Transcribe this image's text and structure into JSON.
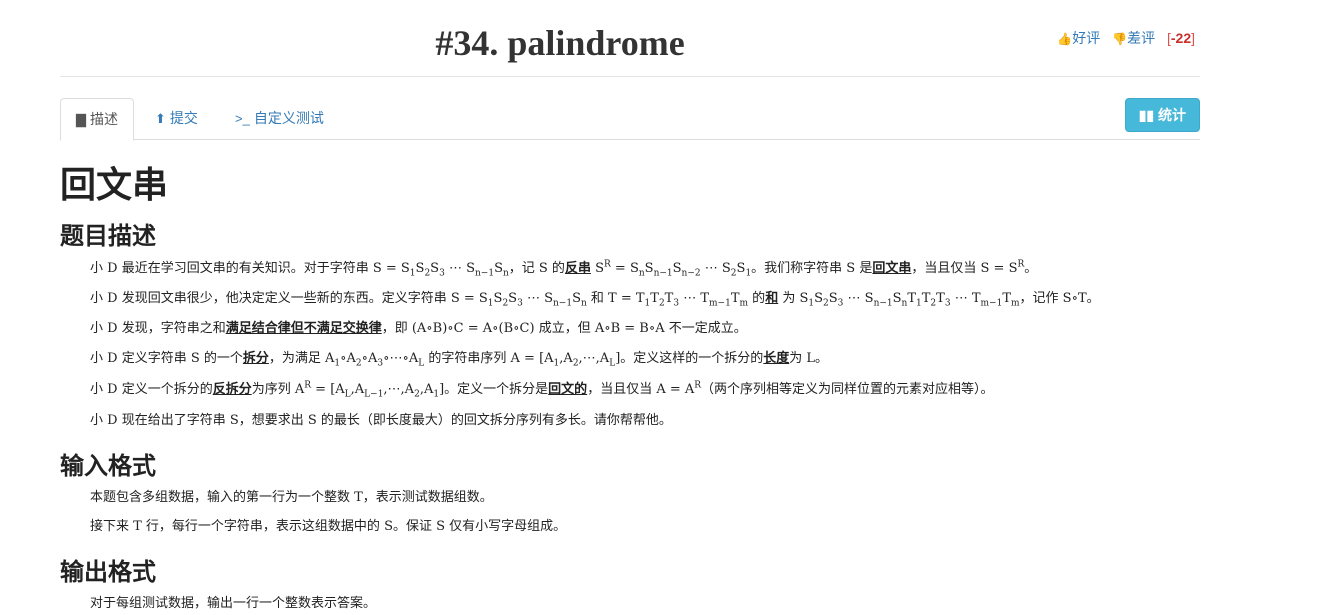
{
  "header": {
    "title": "#34. palindrome",
    "vote": {
      "good_label": "好评",
      "bad_label": "差评",
      "score": "-22"
    }
  },
  "tabs": [
    {
      "label": "描述",
      "icon": "book-icon",
      "active": true
    },
    {
      "label": "提交",
      "icon": "upload-circle-icon",
      "active": false
    },
    {
      "label": "自定义测试",
      "icon": "terminal-icon",
      "active": false
    }
  ],
  "stats_button": {
    "label": "统计",
    "icon": "bar-chart-icon"
  },
  "content": {
    "title": "回文串",
    "sections": {
      "description": "题目描述",
      "input": "输入格式",
      "output": "输出格式"
    },
    "desc": {
      "p1": {
        "a": "小 D 最近在学习回文串的有关知识。对于字符串 ",
        "b": "，记 S 的",
        "c": "反串",
        "d": "。我们称字符串 S 是",
        "e": "回文串",
        "f": "，当且仅当 "
      },
      "p2": {
        "a": "小 D 发现回文串很少，他决定定义一些新的东西。定义字符串 ",
        "b": " 和 ",
        "c": " 的",
        "d": "和",
        "e": " 为 ",
        "f": "，记作 S∘T。"
      },
      "p3": {
        "a": "小 D 发现，字符串之和",
        "b": "满足结合律但不满足交换律",
        "c": "，即 (A∘B)∘C = A∘(B∘C) 成立，但 A∘B = B∘A 不一定成立。"
      },
      "p4": {
        "a": "小 D 定义字符串 S 的一个",
        "b": "拆分",
        "c": "，为满足 ",
        "d": " 的字符串序列 ",
        "e": "。定义这样的一个拆分的",
        "f": "长度",
        "g": "为 L。"
      },
      "p5": {
        "a": "小 D 定义一个拆分的",
        "b": "反拆分",
        "c": "为序列 ",
        "d": "。定义一个拆分是",
        "e": "回文的",
        "f": "，当且仅当 ",
        "g": "（两个序列相等定义为同样位置的元素对应相等）。"
      },
      "p6": "小 D 现在给出了字符串 S，想要求出 S 的最长（即长度最大）的回文拆分序列有多长。请你帮帮他。"
    },
    "input": {
      "p1": "本题包含多组数据，输入的第一行为一个整数 T，表示测试数据组数。",
      "p2": "接下来 T 行，每行一个字符串，表示这组数据中的 S。保证 S 仅有小写字母组成。"
    },
    "output": {
      "p1": "对于每组测试数据，输出一行一个整数表示答案。"
    }
  }
}
